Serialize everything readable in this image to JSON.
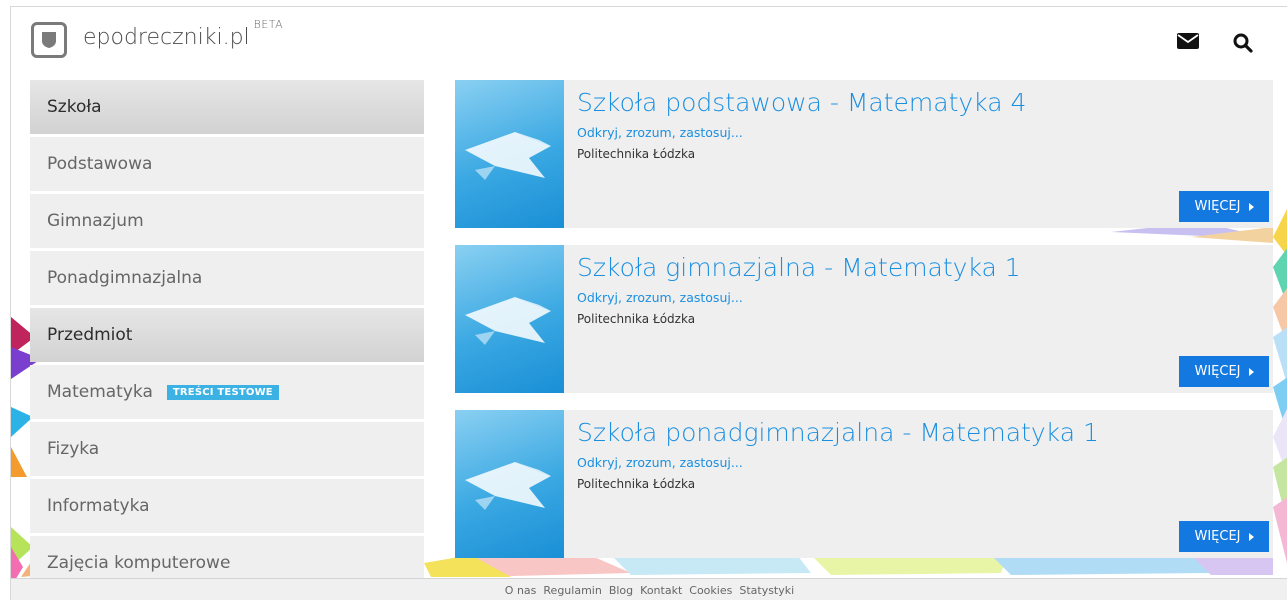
{
  "header": {
    "brand": "epodreczniki.pl",
    "brand_tag": "BETA",
    "icons": [
      "mail-icon",
      "search-icon"
    ]
  },
  "sidebar": {
    "items": [
      {
        "label": "Szkoła",
        "type": "heading"
      },
      {
        "label": "Podstawowa",
        "type": "link"
      },
      {
        "label": "Gimnazjum",
        "type": "link"
      },
      {
        "label": "Ponadgimnazjalna",
        "type": "link"
      },
      {
        "label": "Przedmiot",
        "type": "heading"
      },
      {
        "label": "Matematyka",
        "type": "link",
        "badge": "TREŚCI TESTOWE"
      },
      {
        "label": "Fizyka",
        "type": "link"
      },
      {
        "label": "Informatyka",
        "type": "link"
      },
      {
        "label": "Zajęcia komputerowe",
        "type": "link"
      }
    ]
  },
  "cards": [
    {
      "title": "Szkoła podstawowa - Matematyka 4",
      "subtitle": "Odkryj, zrozum, zastosuj...",
      "org": "Politechnika Łódzka",
      "button": "WIĘCEJ"
    },
    {
      "title": "Szkoła gimnazjalna - Matematyka 1",
      "subtitle": "Odkryj, zrozum, zastosuj...",
      "org": "Politechnika Łódzka",
      "button": "WIĘCEJ"
    },
    {
      "title": "Szkoła ponadgimnazjalna - Matematyka 1",
      "subtitle": "Odkryj, zrozum, zastosuj...",
      "org": "Politechnika Łódzka",
      "button": "WIĘCEJ"
    }
  ],
  "footer": {
    "links": [
      "O nas",
      "Regulamin",
      "Blog",
      "Kontakt",
      "Cookies",
      "Statystyki"
    ]
  },
  "colors": {
    "accent": "#1a8fe0",
    "button": "#1378e0",
    "badge": "#3cb2e4",
    "sidebar_bg": "#efefef"
  }
}
